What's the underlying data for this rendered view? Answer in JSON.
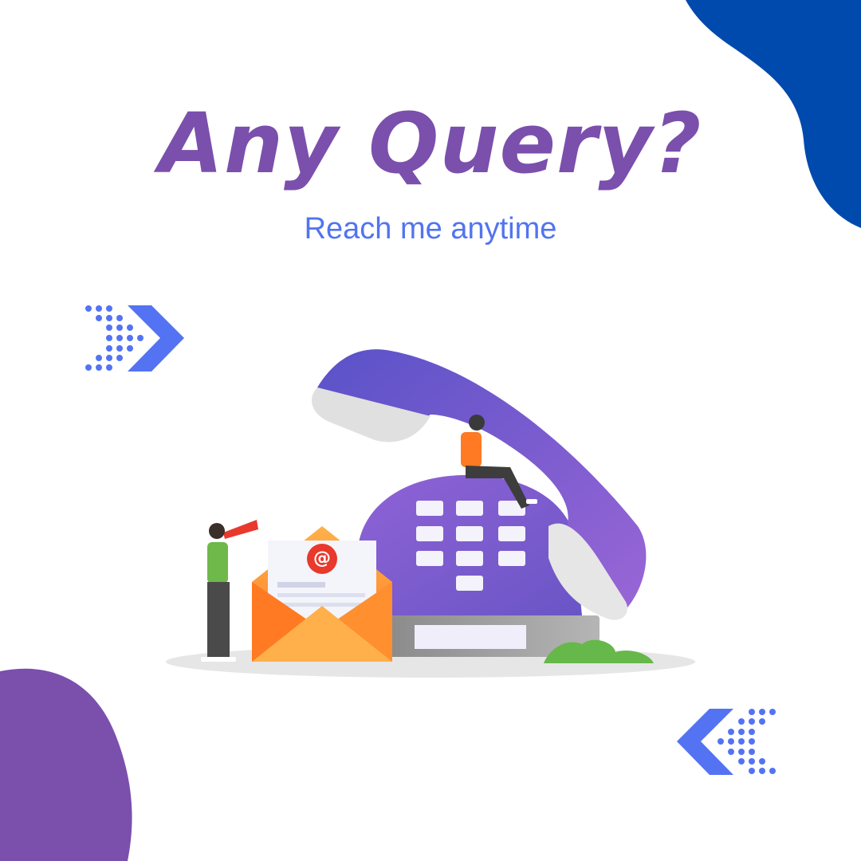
{
  "headline": "Any Query?",
  "subheadline": "Reach me anytime",
  "colors": {
    "headline": "#7b4fac",
    "subheadline": "#5274f0",
    "blob_top_right": "#004aad",
    "blob_bottom_left": "#7b4fac",
    "arrow_accent": "#5473f2",
    "phone_purple": "#7c5ccc",
    "envelope_orange": "#ff8a2a",
    "email_badge": "#e8392c"
  },
  "icons": [
    "dotted-arrow-right-icon",
    "dotted-arrow-left-icon",
    "telephone-illustration",
    "envelope-illustration",
    "at-sign-icon",
    "person-with-telescope-illustration",
    "person-sitting-illustration"
  ],
  "email_symbol": "@"
}
